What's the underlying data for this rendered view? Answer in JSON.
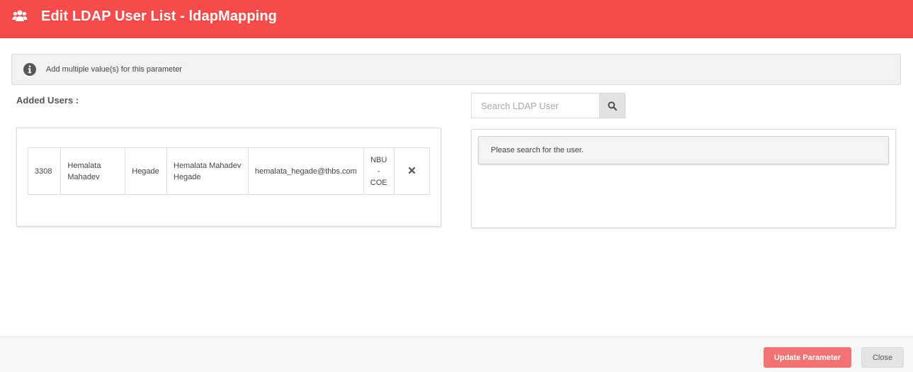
{
  "header": {
    "title": "Edit LDAP User List - ldapMapping",
    "icon": "users-icon",
    "background_color": "#f64b4b"
  },
  "info": {
    "icon": "info-icon",
    "text": "Add multiple value(s) for this parameter"
  },
  "added_users": {
    "label": "Added Users :",
    "rows": [
      {
        "id": "3308",
        "first_name": "Hemalata Mahadev",
        "last_name": "Hegade",
        "full_name": "Hemalata Mahadev Hegade",
        "email": "hemalata_hegade@thbs.com",
        "department": "NBU - COE",
        "remove_icon": "close-icon"
      }
    ]
  },
  "search": {
    "placeholder": "Search LDAP User",
    "button_icon": "search-icon",
    "message": "Please search for the user."
  },
  "footer": {
    "update_label": "Update Parameter",
    "close_label": "Close",
    "update_color": "#f37373"
  }
}
